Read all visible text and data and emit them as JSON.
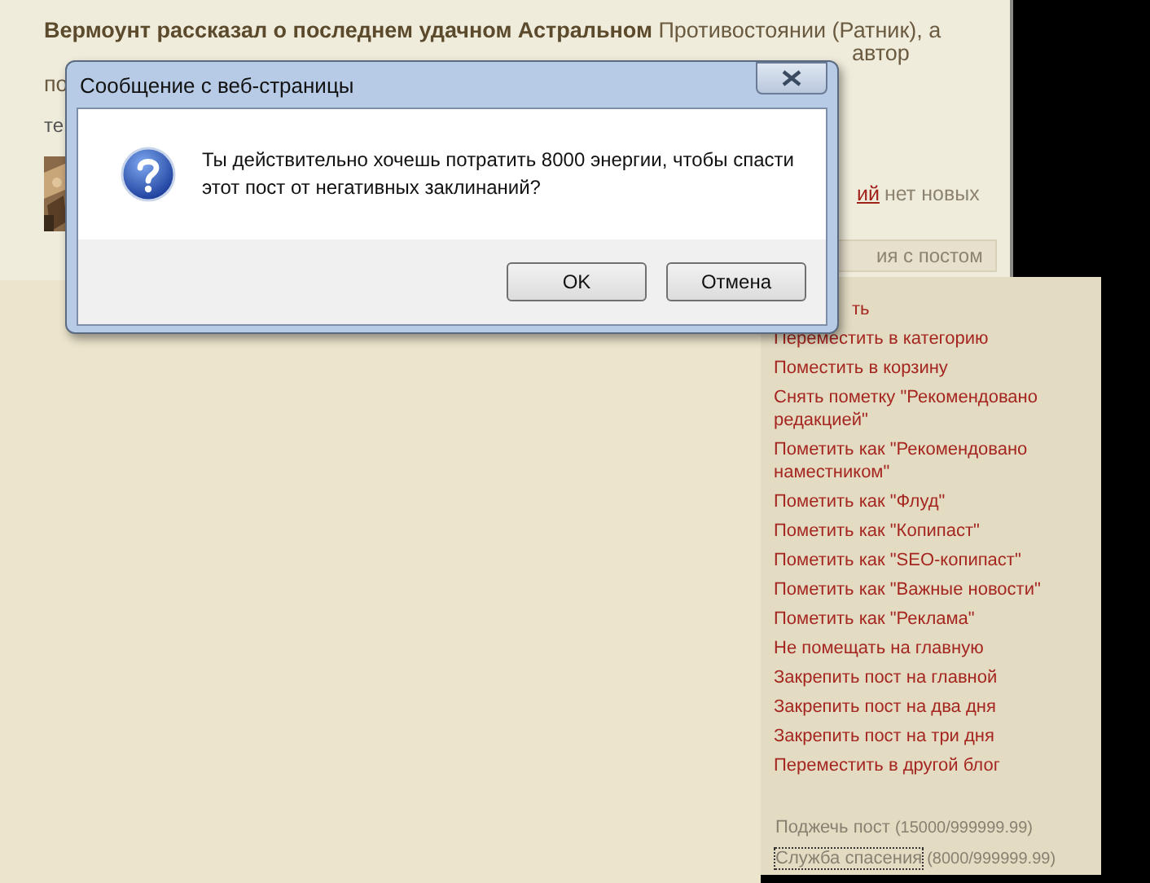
{
  "post": {
    "headline_bold": "Вермоунт рассказал о последнем удачном Астральном",
    "headline_rest": "Противостоянии (Ратник), а",
    "fragment_line2": "автор",
    "fragment_left_1": "по",
    "fragment_left_2": "те",
    "link_fragment": "ий",
    "after_link": "нет новых",
    "action_button": "ия с постом"
  },
  "menu": [
    {
      "kind": "link",
      "label": "ть"
    },
    {
      "kind": "link",
      "label": "Переместить в категорию"
    },
    {
      "kind": "link",
      "label": "Поместить в корзину"
    },
    {
      "kind": "link",
      "label": "Снять пометку \"Рекомендовано редакцией\""
    },
    {
      "kind": "link",
      "label": "Пометить как \"Рекомендовано наместником\""
    },
    {
      "kind": "link",
      "label": "Пометить как \"Флуд\""
    },
    {
      "kind": "link",
      "label": "Пометить как \"Копипаст\""
    },
    {
      "kind": "link",
      "label": "Пометить как \"SEO-копипаст\""
    },
    {
      "kind": "link",
      "label": "Пометить как \"Важные новости\""
    },
    {
      "kind": "link",
      "label": "Пометить как \"Реклама\""
    },
    {
      "kind": "link",
      "label": "Не помещать на главную"
    },
    {
      "kind": "link",
      "label": "Закрепить пост на главной"
    },
    {
      "kind": "link",
      "label": "Закрепить пост на два дня"
    },
    {
      "kind": "link",
      "label": "Закрепить пост на три дня"
    },
    {
      "kind": "link",
      "label": "Переместить в другой блог"
    },
    {
      "kind": "spell",
      "label": "Поджечь пост",
      "cost": "(15000/999999.99)",
      "focused": false
    },
    {
      "kind": "spell",
      "label": "Служба спасения",
      "cost": "(8000/999999.99)",
      "focused": true
    }
  ],
  "dialog": {
    "title": "Сообщение с веб-страницы",
    "message": "Ты действительно хочешь потратить 8000 энергии, чтобы спасти этот пост от негативных заклинаний?",
    "buttons": [
      "OK",
      "Отмена"
    ]
  }
}
